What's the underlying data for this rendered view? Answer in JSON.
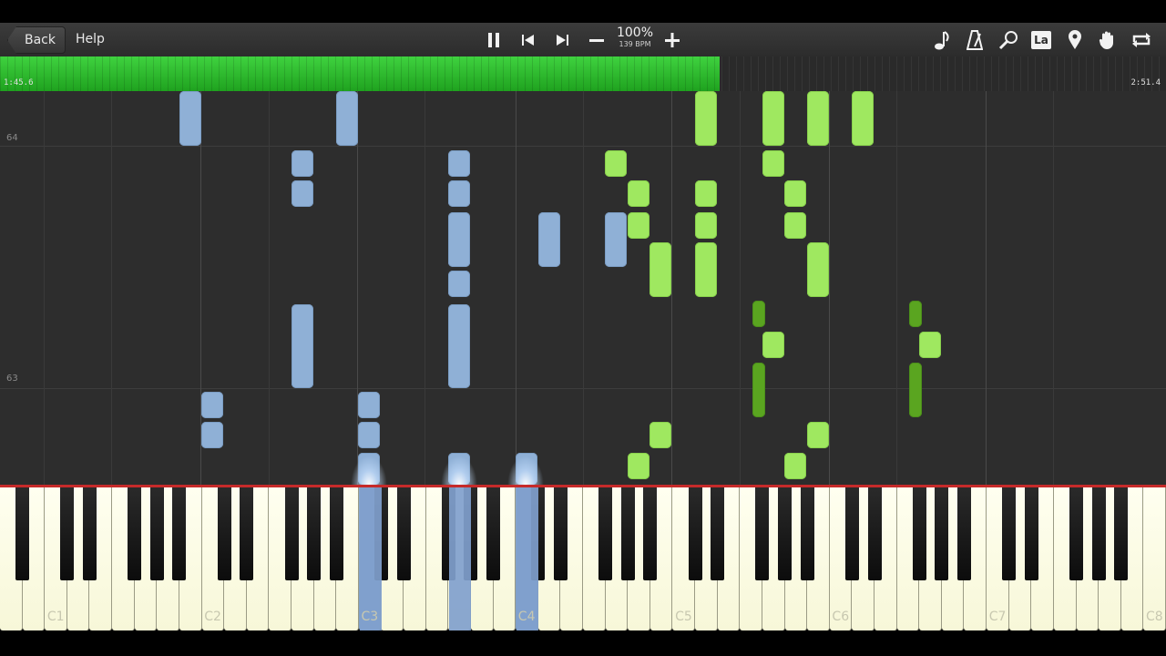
{
  "toolbar": {
    "back_label": "Back",
    "help_label": "Help",
    "tempo_percent": "100%",
    "tempo_bpm": "139 BPM"
  },
  "icons": [
    "pause-icon",
    "skip-back-icon",
    "skip-forward-icon",
    "tempo-minus-icon",
    "tempo-plus-icon",
    "note-icon",
    "metronome-icon",
    "magnifier-icon",
    "note-label-icon",
    "marker-icon",
    "hand-icon",
    "loop-icon"
  ],
  "note_label_text": "La",
  "progress": {
    "elapsed": "1:45.6",
    "total": "2:51.4",
    "fraction": 0.617,
    "fill_color": "#2fc02f"
  },
  "measures": [
    "64",
    "63"
  ],
  "octave_labels": [
    "C1",
    "C2",
    "C3",
    "C4",
    "C5",
    "C6",
    "C7",
    "C8"
  ],
  "colors": {
    "left_hand": "#8fb0d6",
    "right_hand": "#9fe860",
    "right_hand_dark": "#5aa520",
    "keyboard_line": "#c62a2a"
  }
}
